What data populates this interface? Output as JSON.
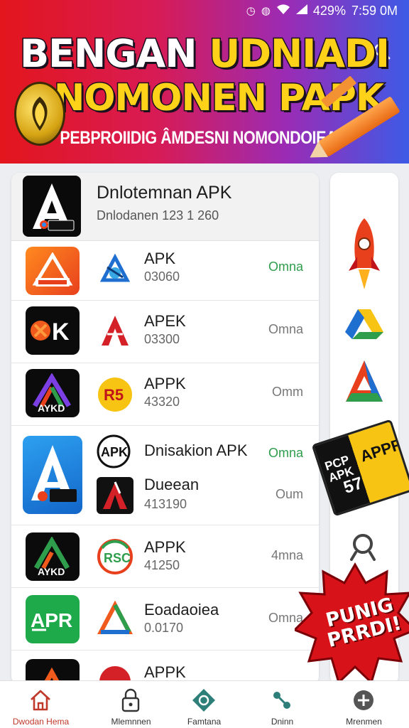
{
  "status_bar": {
    "battery": "429%",
    "time": "7:59 0M"
  },
  "header": {
    "title_word1": "BENGAN",
    "title_word2": "UDNIADI",
    "title_line2_a": "NOMONEN ",
    "title_line2_b": "PAPK",
    "subtitle": "PEBPROIIDIG ÂMDESNI NOMONDOIEAM"
  },
  "featured": {
    "title": "Dnlotemnan APK",
    "subtitle": "Dnlodanen 123 1 260"
  },
  "rows": [
    {
      "name": "APK",
      "number": "03060",
      "status": "Omna",
      "status_color": "#2e9d4c"
    },
    {
      "name": "APEK",
      "number": "03300",
      "status": "Omna",
      "status_color": "#777777"
    },
    {
      "name": "APPK",
      "number": "43320",
      "status": "Omm",
      "status_color": "#777777"
    },
    {
      "name": "Dnisakion APK",
      "name2": "Dueean",
      "number": "413190",
      "status": "Omna",
      "status2": "Oum",
      "status_color": "#2e9d4c"
    },
    {
      "name": "APPK",
      "number": "41250",
      "status": "4mna",
      "status_color": "#777777"
    },
    {
      "name": "Eoadaoiea",
      "number": "0.0170",
      "status": "Omna",
      "status_color": "#777777"
    },
    {
      "name": "APPK",
      "number": "",
      "status": "",
      "status_color": "#777777"
    }
  ],
  "sticker": {
    "left": "PCP",
    "left2": "APK",
    "right": "APPR",
    "num": "57"
  },
  "promo": {
    "text": "PUNIG PRRDI!"
  },
  "nav": [
    {
      "label": "Dwodan Hema",
      "icon": "home-icon"
    },
    {
      "label": "Mlemnnen",
      "icon": "lock-icon"
    },
    {
      "label": "Famtana",
      "icon": "diamond-icon"
    },
    {
      "label": "Dninn",
      "icon": "network-icon"
    },
    {
      "label": "Mrenmen",
      "icon": "plus-icon"
    }
  ],
  "colors": {
    "accent": "#c0392b",
    "green": "#2e9d4c",
    "banner_red": "#e3161d",
    "banner_blue": "#3d5be6"
  }
}
